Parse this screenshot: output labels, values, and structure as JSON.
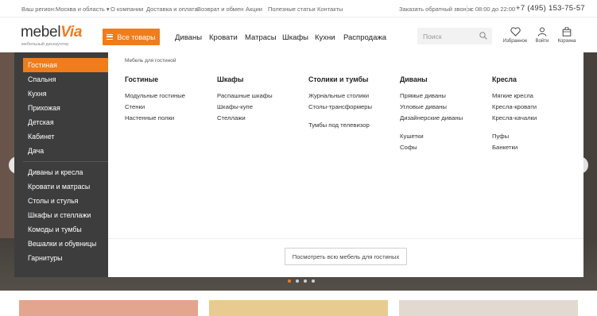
{
  "topbar": {
    "region_label": "Ваш регион:",
    "region_value": "Москва и область",
    "links": [
      "О компании",
      "Доставка и оплата",
      "Возврат и обмен",
      "Акции",
      "Полезные статьи",
      "Контакты"
    ],
    "callback": "Заказать обратный звонок",
    "hours": "с 08:00 до 22:00",
    "phone": "+7 (495) 153-75-57"
  },
  "header": {
    "logo_main": "mebel",
    "logo_accent": "Via",
    "logo_sub": "мебельный дискаунтер",
    "all_goods": "Все товары",
    "nav": [
      "Диваны",
      "Кровати",
      "Матрасы",
      "Шкафы",
      "Кухни",
      "Распродажа"
    ],
    "search_placeholder": "Поиск",
    "icons": [
      {
        "name": "heart-icon",
        "label": "Избранное"
      },
      {
        "name": "user-icon",
        "label": "Войти"
      },
      {
        "name": "basket-icon",
        "label": "Корзина"
      }
    ]
  },
  "sidebar": {
    "group1": [
      "Гостиная",
      "Спальня",
      "Кухня",
      "Прихожая",
      "Детская",
      "Кабинет",
      "Дача"
    ],
    "group2": [
      "Диваны и кресла",
      "Кровати и матрасы",
      "Столы и стулья",
      "Шкафы и стеллажи",
      "Комоды и тумбы",
      "Вешалки и обувницы",
      "Гарнитуры"
    ]
  },
  "mega": {
    "crumb": "Мебель для гостиной",
    "columns": [
      {
        "title": "Гостиные",
        "groups": [
          [
            "Модульные гостиные",
            "Стенки",
            "Настенные полки"
          ]
        ]
      },
      {
        "title": "Шкафы",
        "groups": [
          [
            "Распашные шкафы",
            "Шкафы-купе",
            "Стеллажи"
          ]
        ]
      },
      {
        "title": "Столики и тумбы",
        "groups": [
          [
            "Журнальные столики",
            "Столы-трансформеры"
          ],
          [
            "Тумбы под телевизор"
          ]
        ]
      },
      {
        "title": "Диваны",
        "groups": [
          [
            "Прямые диваны",
            "Угловые диваны",
            "Дизайнерские диваны"
          ],
          [
            "Кушетки",
            "Софы"
          ]
        ]
      },
      {
        "title": "Кресла",
        "groups": [
          [
            "Мягкие кресла",
            "Кресла-кровати",
            "Кресла-качалки"
          ],
          [
            "Пуфы",
            "Банкетки"
          ]
        ]
      }
    ],
    "view_all": "Посмотреть всю мебель для гостиных"
  },
  "colors": {
    "accent": "#f07c1c",
    "sidebar_bg": "#3d3d3d"
  }
}
